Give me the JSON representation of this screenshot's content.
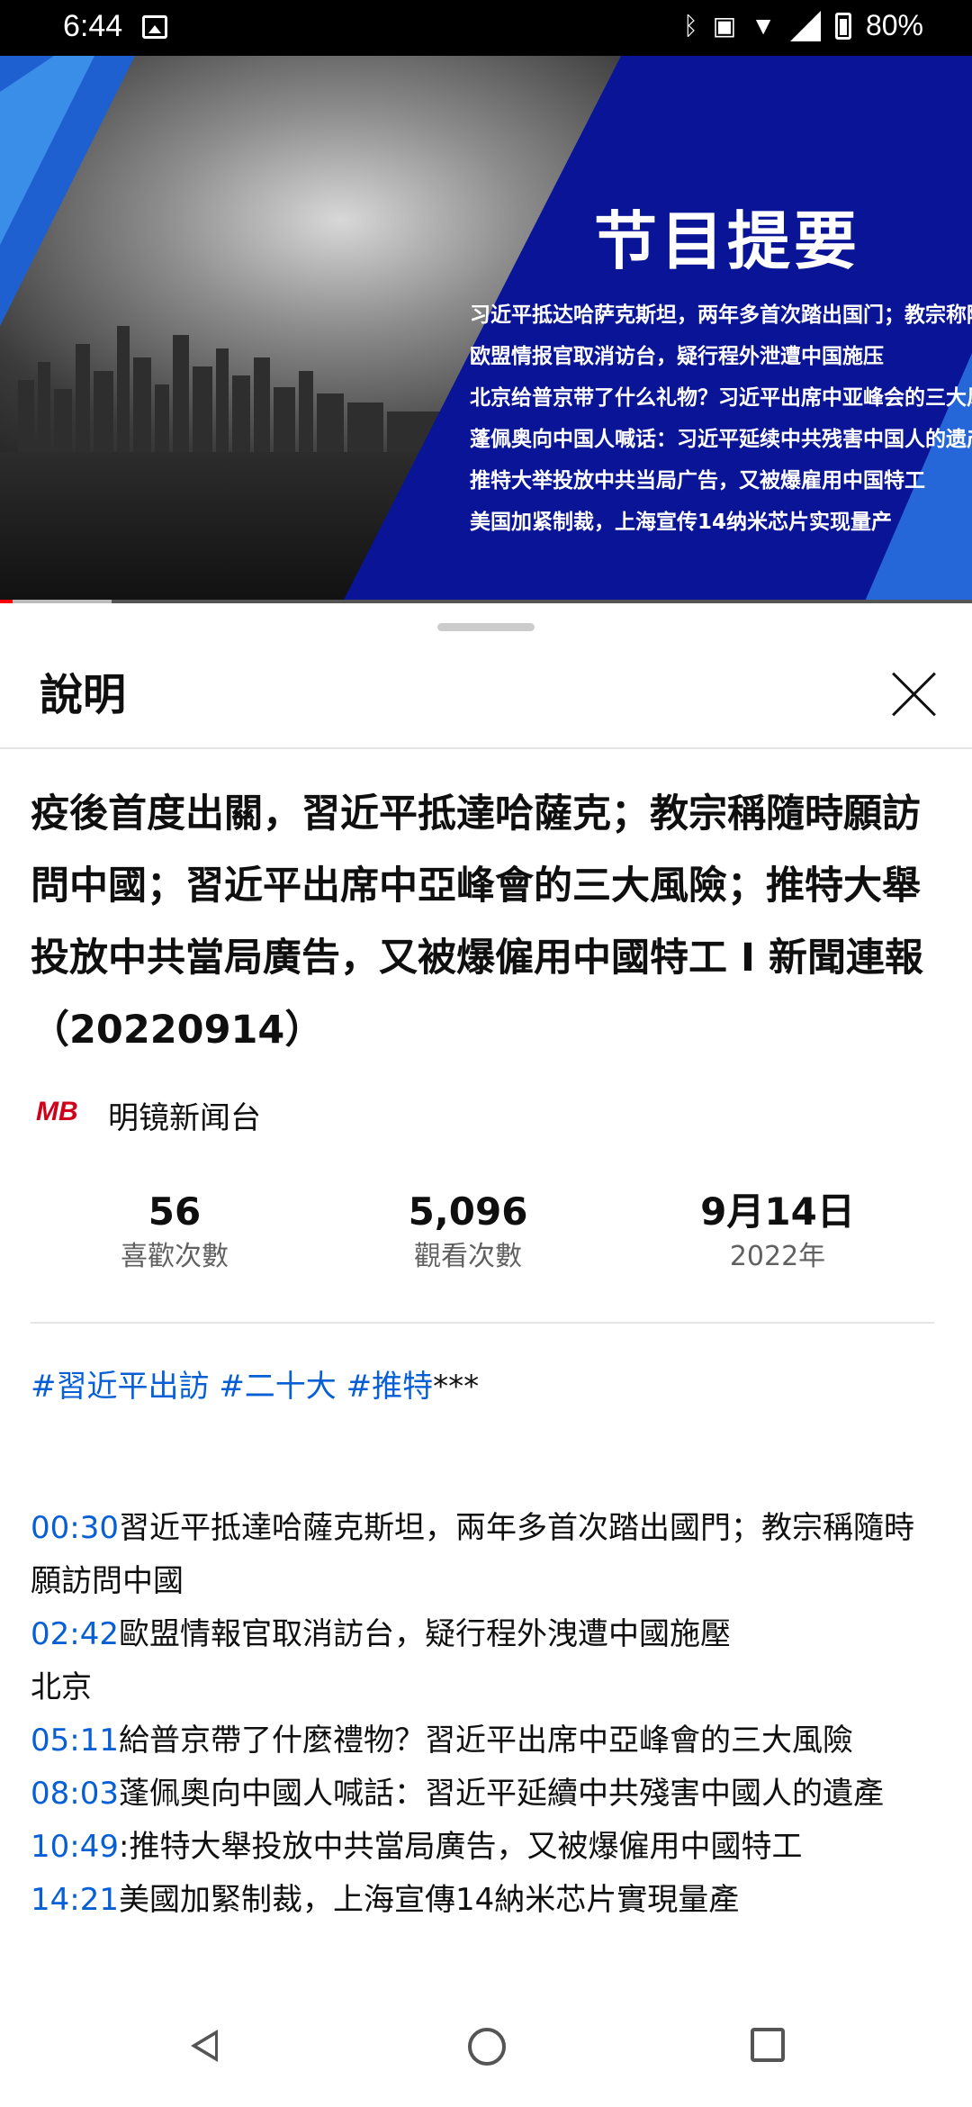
{
  "status_bar": {
    "time": "6:44",
    "battery": "80%",
    "icons": [
      "image-icon",
      "bluetooth-icon",
      "nfc-icon",
      "wifi-icon",
      "signal-icon",
      "battery-icon"
    ]
  },
  "video": {
    "banner_title": "节目提要",
    "banner_lines": [
      "习近平抵达哈萨克斯坦，两年多首次踏出国门；教宗称随时愿访问中国",
      "欧盟情报官取消访台，疑行程外泄遭中国施压",
      "北京给普京带了什么礼物？习近平出席中亚峰会的三大风险",
      "蓬佩奥向中国人喊话：习近平延续中共残害中国人的遗产",
      "推特大举投放中共当局广告，又被爆雇用中国特工",
      "美国加紧制裁，上海宣传14纳米芯片实现量产"
    ]
  },
  "sheet": {
    "title": "說明",
    "video_title": "疫後首度出關，習近平抵達哈薩克；教宗稱隨時願訪問中國；習近平出席中亞峰會的三大風險；推特大舉投放中共當局廣告，又被爆僱用中國特工 I 新聞連報（20220914）",
    "channel": {
      "name": "明镜新闻台",
      "logo_text": "MB"
    },
    "stats": {
      "likes_value": "56",
      "likes_label": "喜歡次數",
      "views_value": "5,096",
      "views_label": "觀看次數",
      "date_value": "9月14日",
      "date_label": "2022年"
    },
    "hashtags": [
      "#習近平出訪",
      "#二十大",
      "#推特"
    ],
    "hashtags_suffix": "***",
    "chapters": [
      {
        "time": "00:30",
        "text": "習近平抵達哈薩克斯坦，兩年多首次踏出國門；教宗稱隨時願訪問中國"
      },
      {
        "time": "02:42",
        "text": "歐盟情報官取消訪台，疑行程外洩遭中國施壓"
      },
      {
        "time": "",
        "text": "北京"
      },
      {
        "time": "05:11",
        "text": "給普京帶了什麼禮物？習近平出席中亞峰會的三大風險"
      },
      {
        "time": "08:03",
        "text": "蓬佩奧向中國人喊話：習近平延續中共殘害中國人的遺產"
      },
      {
        "time": "10:49",
        "text": ":推特大舉投放中共當局廣告，又被爆僱用中國特工"
      },
      {
        "time": "14:21",
        "text": "美國加緊制裁，上海宣傳14納米芯片實現量產"
      }
    ]
  },
  "nav": {
    "icons": [
      "back-icon",
      "home-icon",
      "recents-icon"
    ]
  }
}
